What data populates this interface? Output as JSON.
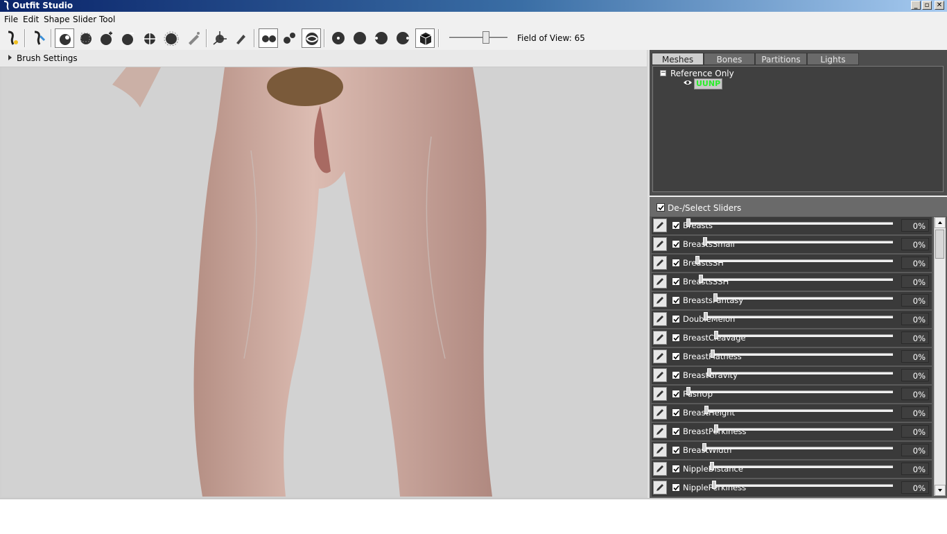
{
  "window": {
    "title": "Outfit Studio"
  },
  "menu": [
    "File",
    "Edit",
    "Shape",
    "Slider",
    "Tool"
  ],
  "toolbar": {
    "fov_label": "Field of View: 65",
    "fov_value": 65,
    "fov_min": 0,
    "fov_max": 100
  },
  "viewport": {
    "brush_settings_label": "Brush Settings"
  },
  "mesh_panel": {
    "tabs": [
      "Meshes",
      "Bones",
      "Partitions",
      "Lights"
    ],
    "active_tab": "Meshes",
    "tree_root": "Reference Only",
    "tree_root_expander": "−",
    "mesh_name": "UUNP"
  },
  "slider_panel": {
    "deselect_label": "De-/Select Sliders",
    "sliders": [
      {
        "name": "Breasts",
        "value": "0%"
      },
      {
        "name": "BreastsSmall",
        "value": "0%"
      },
      {
        "name": "BreastsSH",
        "value": "0%"
      },
      {
        "name": "BreastsSSH",
        "value": "0%"
      },
      {
        "name": "BreastsFantasy",
        "value": "0%"
      },
      {
        "name": "DoubleMelon",
        "value": "0%"
      },
      {
        "name": "BreastCleavage",
        "value": "0%"
      },
      {
        "name": "BreastFlatness",
        "value": "0%"
      },
      {
        "name": "BreastGravity",
        "value": "0%"
      },
      {
        "name": "PushUp",
        "value": "0%"
      },
      {
        "name": "BreastHeight",
        "value": "0%"
      },
      {
        "name": "BreastPerkiness",
        "value": "0%"
      },
      {
        "name": "BreastWidth",
        "value": "0%"
      },
      {
        "name": "NippleDistance",
        "value": "0%"
      },
      {
        "name": "NipplePerkiness",
        "value": "0%"
      }
    ]
  },
  "colors": {
    "panel_dark": "#4d4d4d",
    "slider_row": "#3a3a3a",
    "mesh_label": "#2aee2a",
    "title_gradient_start": "#0a246a"
  }
}
